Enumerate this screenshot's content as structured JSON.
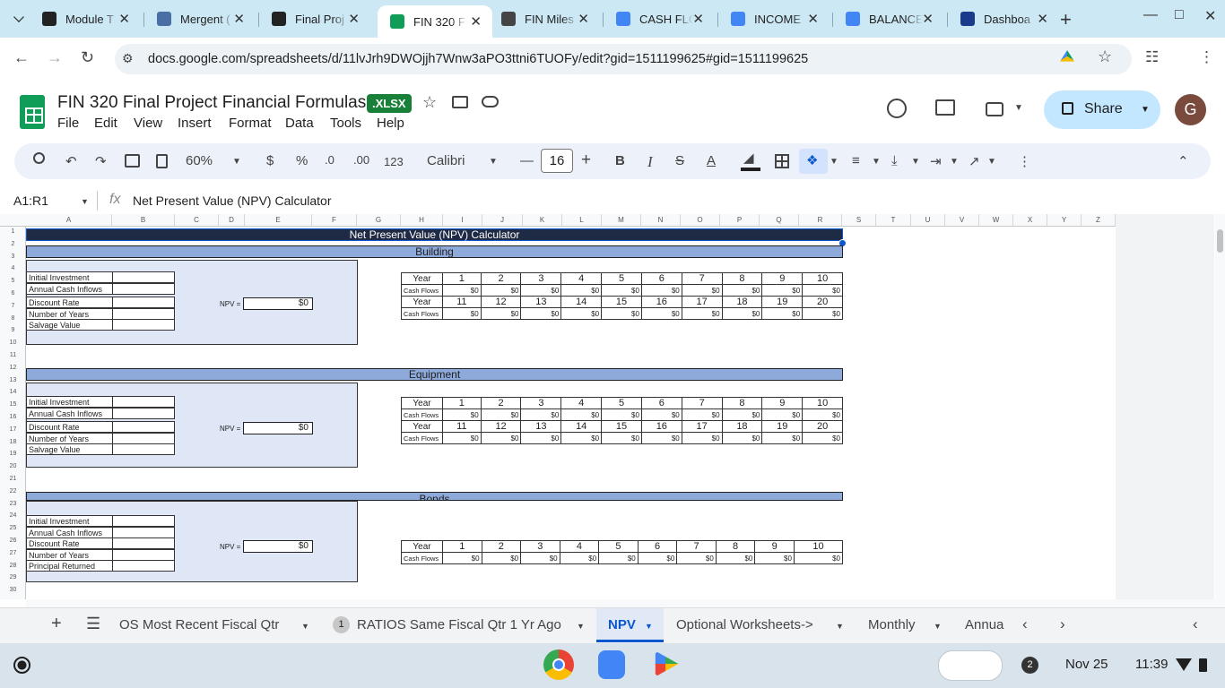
{
  "browser": {
    "tabs": [
      {
        "title": "Module T",
        "color": "#222222"
      },
      {
        "title": "Mergent (",
        "color": "#4a6fa5"
      },
      {
        "title": "Final Proj",
        "color": "#222222"
      },
      {
        "title": "FIN 320 F",
        "color": "#0f9d58"
      },
      {
        "title": "FIN Miles",
        "color": "#444444"
      },
      {
        "title": "CASH FLO",
        "color": "#4285f4"
      },
      {
        "title": "INCOME",
        "color": "#4285f4"
      },
      {
        "title": "BALANCE",
        "color": "#4285f4"
      },
      {
        "title": "Dashboa",
        "color": "#1a3b8c"
      }
    ],
    "url": "docs.google.com/spreadsheets/d/11lvJrh9DWOjjh7Wnw3aPO3ttni6TUOFy/edit?gid=1511199625#gid=1511199625"
  },
  "doc": {
    "title": "FIN 320 Final Project Financial Formulas",
    "badge": ".XLSX",
    "menus": [
      "File",
      "Edit",
      "View",
      "Insert",
      "Format",
      "Data",
      "Tools",
      "Help"
    ],
    "share": "Share",
    "avatar": "G"
  },
  "toolbar": {
    "zoom": "60%",
    "currency": "$",
    "percent": "%",
    "dec_less": ".0",
    "dec_more": ".00",
    "numfmt": "123",
    "font": "Calibri",
    "font_size": "16",
    "bold": "B",
    "italic": "I",
    "strike": "S",
    "textcolor": "A"
  },
  "formula_bar": {
    "name_box": "A1:R1",
    "fx": "fx",
    "formula": "Net Present Value (NPV) Calculator"
  },
  "columns": [
    "A",
    "B",
    "C",
    "D",
    "E",
    "F",
    "G",
    "H",
    "I",
    "J",
    "K",
    "L",
    "M",
    "N",
    "O",
    "P",
    "Q",
    "R",
    "S",
    "T",
    "U",
    "V",
    "W",
    "X",
    "Y",
    "Z"
  ],
  "rows": [
    "1",
    "2",
    "3",
    "4",
    "5",
    "6",
    "7",
    "8",
    "9",
    "10",
    "11",
    "12",
    "13",
    "14",
    "15",
    "16",
    "17",
    "18",
    "19",
    "20",
    "21",
    "22",
    "23",
    "24",
    "25",
    "26",
    "27",
    "28",
    "29",
    "30"
  ],
  "sheet": {
    "title": "Net Present Value (NPV) Calculator",
    "npv_label": "NPV =",
    "year_label": "Year",
    "cf_label": "Cash Flows",
    "years_a": [
      "1",
      "2",
      "3",
      "4",
      "5",
      "6",
      "7",
      "8",
      "9",
      "10"
    ],
    "years_b": [
      "11",
      "12",
      "13",
      "14",
      "15",
      "16",
      "17",
      "18",
      "19",
      "20"
    ],
    "cf_value": "$0",
    "sections": [
      {
        "name": "Building",
        "labels": [
          "Initial Investment",
          "Annual Cash Inflows",
          "Discount Rate",
          "Number of Years",
          "Salvage Value"
        ],
        "npv": "$0"
      },
      {
        "name": "Equipment",
        "labels": [
          "Initial Investment",
          "Annual Cash Inflows",
          "Discount Rate",
          "Number of Years",
          "Salvage Value"
        ],
        "npv": "$0"
      },
      {
        "name": "Bonds",
        "labels": [
          "Initial Investment",
          "Annual Cash Inflows",
          "Discount Rate",
          "Number of Years",
          "Principal Returned"
        ],
        "npv": "$0"
      }
    ]
  },
  "sheet_tabs": {
    "tab1": "OS Most Recent Fiscal Qtr",
    "badge": "1",
    "tab2": "RATIOS Same Fiscal Qtr 1 Yr Ago",
    "tab3": "NPV",
    "tab4": "Optional Worksheets->",
    "tab5": "Monthly",
    "tab6": "Annua"
  },
  "shelf": {
    "notifications": "2",
    "date": "Nov 25",
    "time": "11:39"
  }
}
